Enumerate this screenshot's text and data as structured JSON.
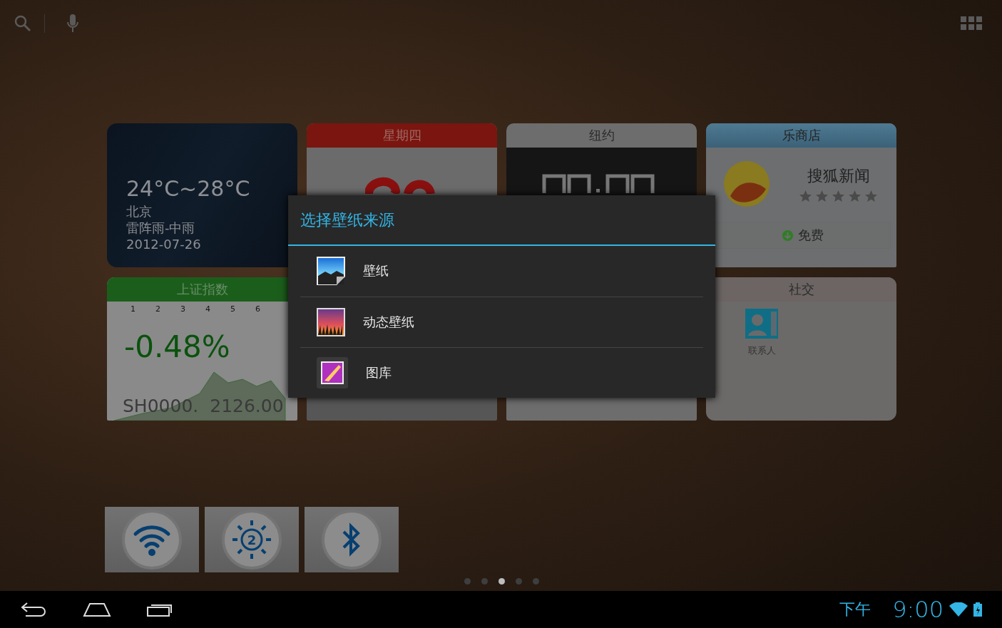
{
  "weather": {
    "temp_range": "24°C~28°C",
    "city": "北京",
    "condition": "雷阵雨-中雨",
    "date": "2012-07-26"
  },
  "calendar": {
    "weekday": "星期四"
  },
  "clock": {
    "city": "纽约"
  },
  "store": {
    "title": "乐商店",
    "app_name": "搜狐新闻",
    "stars": 0,
    "price": "免费"
  },
  "stock": {
    "title": "上证指数",
    "ticks": [
      "1",
      "2",
      "3",
      "4",
      "5",
      "6"
    ],
    "change": "-0.48%",
    "code": "SH0000.",
    "value": "2126.00"
  },
  "social": {
    "title": "社交",
    "contact_label": "联系人"
  },
  "dialog": {
    "title": "选择壁纸来源",
    "items": [
      {
        "kind": "wallpaper",
        "label": "壁纸"
      },
      {
        "kind": "live",
        "label": "动态壁纸"
      },
      {
        "kind": "gallery",
        "label": "图库"
      }
    ]
  },
  "toggles": [
    {
      "kind": "wifi",
      "on": true
    },
    {
      "kind": "brightness",
      "on": true,
      "label": "2"
    },
    {
      "kind": "bluetooth",
      "on": true
    }
  ],
  "page_dots": [
    {
      "selected": false
    },
    {
      "selected": false
    },
    {
      "selected": true
    },
    {
      "selected": false
    },
    {
      "selected": false
    }
  ],
  "status": {
    "period": "下午",
    "time": "9:00"
  }
}
